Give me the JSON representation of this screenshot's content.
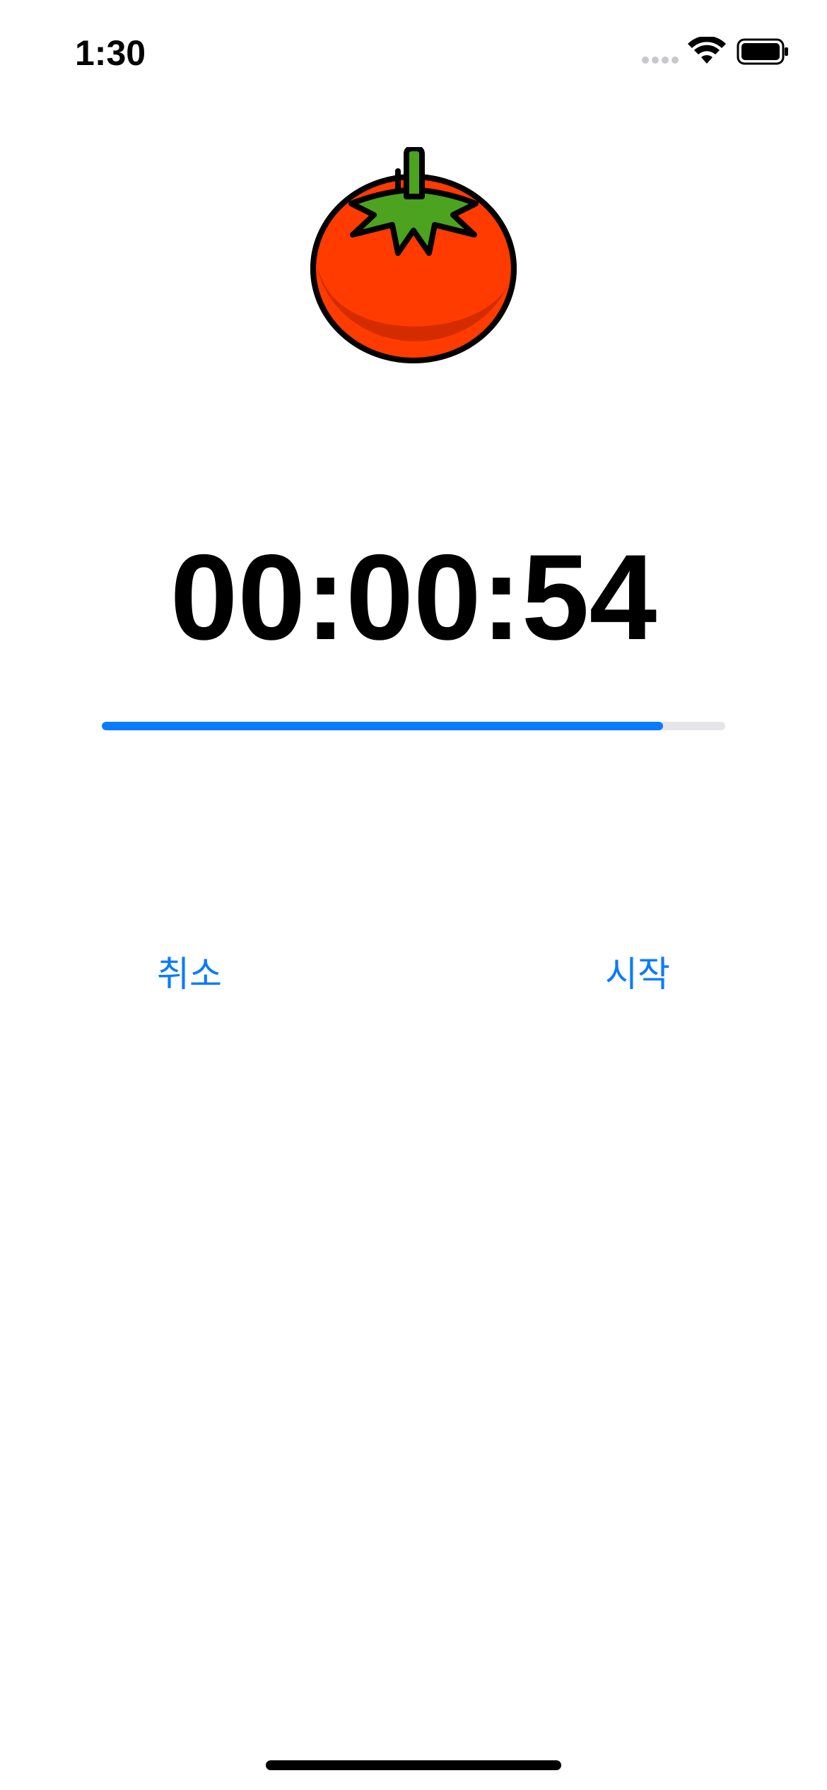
{
  "status_bar": {
    "time": "1:30",
    "signal_icon": "cellular-signal-icon",
    "wifi_icon": "wifi-icon",
    "battery_icon": "battery-icon"
  },
  "app": {
    "image_icon": "tomato-icon",
    "timer_text": "00:00:54",
    "progress_fraction": 0.9,
    "cancel_label": "취소",
    "start_label": "시작"
  },
  "colors": {
    "accent": "#0A7AFF",
    "progress_track": "#E5E5EA",
    "tomato_red": "#FF3B00",
    "tomato_shade": "#CC2A00",
    "leaf_green": "#4CA31F"
  }
}
